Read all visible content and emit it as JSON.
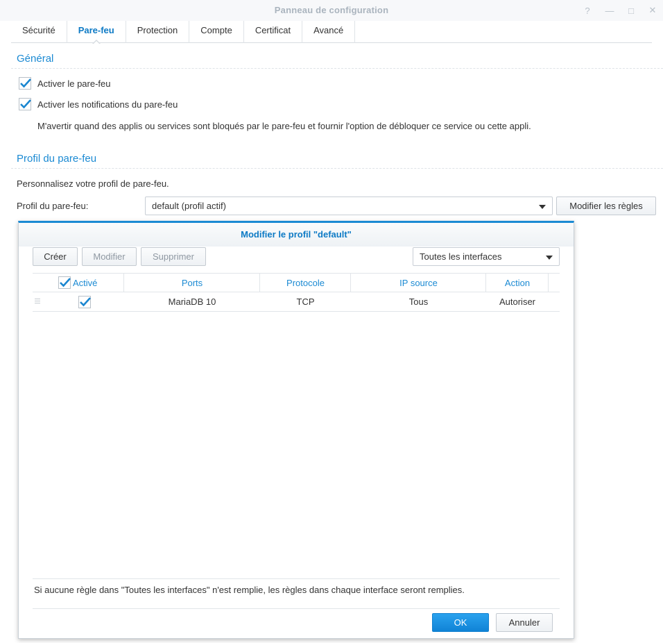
{
  "window": {
    "title": "Panneau de configuration",
    "help_glyph": "?",
    "minimize_glyph": "—",
    "maximize_glyph": "□",
    "close_glyph": "✕"
  },
  "tabs": [
    {
      "label": "Sécurité"
    },
    {
      "label": "Pare-feu",
      "active": true
    },
    {
      "label": "Protection"
    },
    {
      "label": "Compte"
    },
    {
      "label": "Certificat"
    },
    {
      "label": "Avancé"
    }
  ],
  "general": {
    "title": "Général",
    "enable_firewall": {
      "label": "Activer le pare-feu",
      "checked": true
    },
    "enable_notifications": {
      "label": "Activer les notifications du pare-feu",
      "checked": true
    },
    "notification_desc": "M'avertir quand des applis ou services sont bloqués par le pare-feu et fournir l'option de débloquer ce service ou cette appli."
  },
  "profile": {
    "title": "Profil du pare-feu",
    "description": "Personnalisez votre profil de pare-feu.",
    "field_label": "Profil du pare-feu:",
    "selected": "default (profil actif)",
    "modify_rules_button": "Modifier les règles"
  },
  "dialog": {
    "title": "Modifier le profil \"default\"",
    "create_button": "Créer",
    "edit_button": "Modifier",
    "delete_button": "Supprimer",
    "interface_select": "Toutes les interfaces",
    "columns": {
      "active": "Activé",
      "ports": "Ports",
      "protocol": "Protocole",
      "source_ip": "IP source",
      "action": "Action"
    },
    "rows": [
      {
        "active": true,
        "ports": "MariaDB 10",
        "protocol": "TCP",
        "source_ip": "Tous",
        "action": "Autoriser"
      }
    ],
    "note": "Si aucune règle dans \"Toutes les interfaces\" n'est remplie, les règles dans chaque interface seront remplies.",
    "ok_button": "OK",
    "cancel_button": "Annuler"
  },
  "colors": {
    "accent": "#1b8ad3",
    "check": "#1a86d0",
    "primary_button": "#1a90e2"
  }
}
